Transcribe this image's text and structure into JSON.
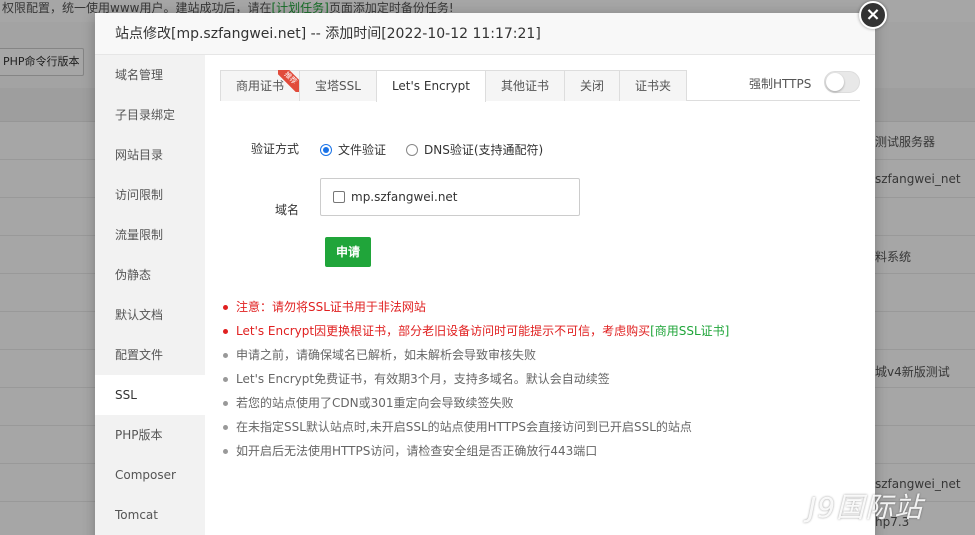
{
  "background": {
    "top_notice_prefix": "权限配置，统一使用www用户。建站成功后，请在",
    "top_notice_link": "[计划任务]",
    "top_notice_suffix": "页面添加定时备份任务!",
    "php_cli_button": "PHP命令行版本",
    "right_texts": [
      "测试服务器",
      "szfangwei_net",
      "料系统",
      "城v4新版测试",
      "szfangwei_net",
      "hp7.3"
    ]
  },
  "dialog": {
    "title": "站点修改[mp.szfangwei.net] -- 添加时间[2022-10-12 11:17:21]",
    "close_icon": "×"
  },
  "sidebar": {
    "items": [
      "域名管理",
      "子目录绑定",
      "网站目录",
      "访问限制",
      "流量限制",
      "伪静态",
      "默认文档",
      "配置文件",
      "SSL",
      "PHP版本",
      "Composer",
      "Tomcat"
    ],
    "active": "SSL"
  },
  "ssl": {
    "tabs": [
      "商用证书",
      "宝塔SSL",
      "Let's Encrypt",
      "其他证书",
      "关闭",
      "证书夹"
    ],
    "active_tab": "Let's Encrypt",
    "ribbon_text": "推荐",
    "force_https_label": "强制HTTPS",
    "force_https_enabled": false,
    "verify_label": "验证方式",
    "verify_file": "文件验证",
    "verify_dns": "DNS验证(支持通配符)",
    "domain_label": "域名",
    "domain_value": "mp.szfangwei.net",
    "apply_button": "申请",
    "tips": [
      {
        "text": "注意：请勿将SSL证书用于非法网站",
        "color": "red"
      },
      {
        "text": "Let's Encrypt因更换根证书，部分老旧设备访问时可能提示不可信，考虑购买",
        "link": "[商用SSL证书]",
        "color": "red"
      },
      {
        "text": "申请之前，请确保域名已解析，如未解析会导致审核失败",
        "color": "gray"
      },
      {
        "text": "Let's Encrypt免费证书，有效期3个月，支持多域名。默认会自动续签",
        "color": "gray"
      },
      {
        "text": "若您的站点使用了CDN或301重定向会导致续签失败",
        "color": "gray"
      },
      {
        "text": "在未指定SSL默认站点时,未开启SSL的站点使用HTTPS会直接访问到已开启SSL的站点",
        "color": "gray"
      },
      {
        "text": "如开启后无法使用HTTPS访问，请检查安全组是否正确放行443端口",
        "color": "gray"
      }
    ]
  },
  "watermark": "J9国际站",
  "colors": {
    "accent": "#20a53a",
    "danger": "#e02020",
    "radio": "#1a73e8"
  }
}
